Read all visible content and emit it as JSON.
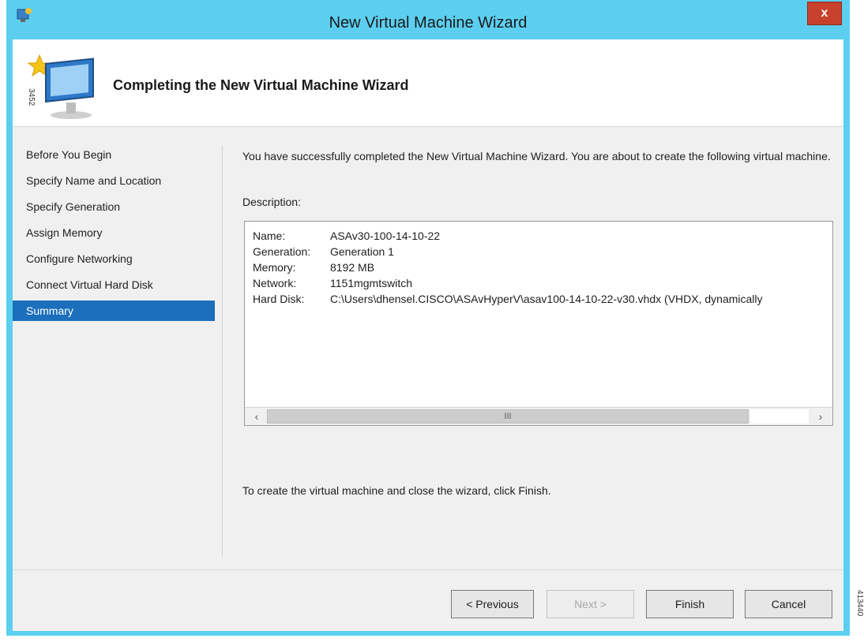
{
  "window": {
    "title": "New Virtual Machine Wizard",
    "close_label": "x"
  },
  "header": {
    "title": "Completing the New Virtual Machine Wizard",
    "rotated_id": "3452"
  },
  "nav": {
    "items": [
      {
        "label": "Before You Begin"
      },
      {
        "label": "Specify Name and Location"
      },
      {
        "label": "Specify Generation"
      },
      {
        "label": "Assign Memory"
      },
      {
        "label": "Configure Networking"
      },
      {
        "label": "Connect Virtual Hard Disk"
      },
      {
        "label": "Summary",
        "selected": true
      }
    ]
  },
  "content": {
    "intro": "You have successfully completed the New Virtual Machine Wizard. You are about to create the following virtual machine.",
    "description_label": "Description:",
    "summary": [
      {
        "key": "Name:",
        "value": "ASAv30-100-14-10-22"
      },
      {
        "key": "Generation:",
        "value": "Generation 1"
      },
      {
        "key": "Memory:",
        "value": "8192 MB"
      },
      {
        "key": "Network:",
        "value": "1151mgmtswitch"
      },
      {
        "key": "Hard Disk:",
        "value": "C:\\Users\\dhensel.CISCO\\ASAvHyperV\\asav100-14-10-22-v30.vhdx (VHDX, dynamically"
      }
    ],
    "scroll_grip": "III",
    "finish_hint": "To create the virtual machine and close the wizard, click Finish."
  },
  "buttons": {
    "previous": "< Previous",
    "next": "Next >",
    "finish": "Finish",
    "cancel": "Cancel"
  },
  "figure_id": "413440",
  "colors": {
    "titlebar": "#5ccff0",
    "close": "#c8412c",
    "selected_nav": "#1c6fbb"
  }
}
